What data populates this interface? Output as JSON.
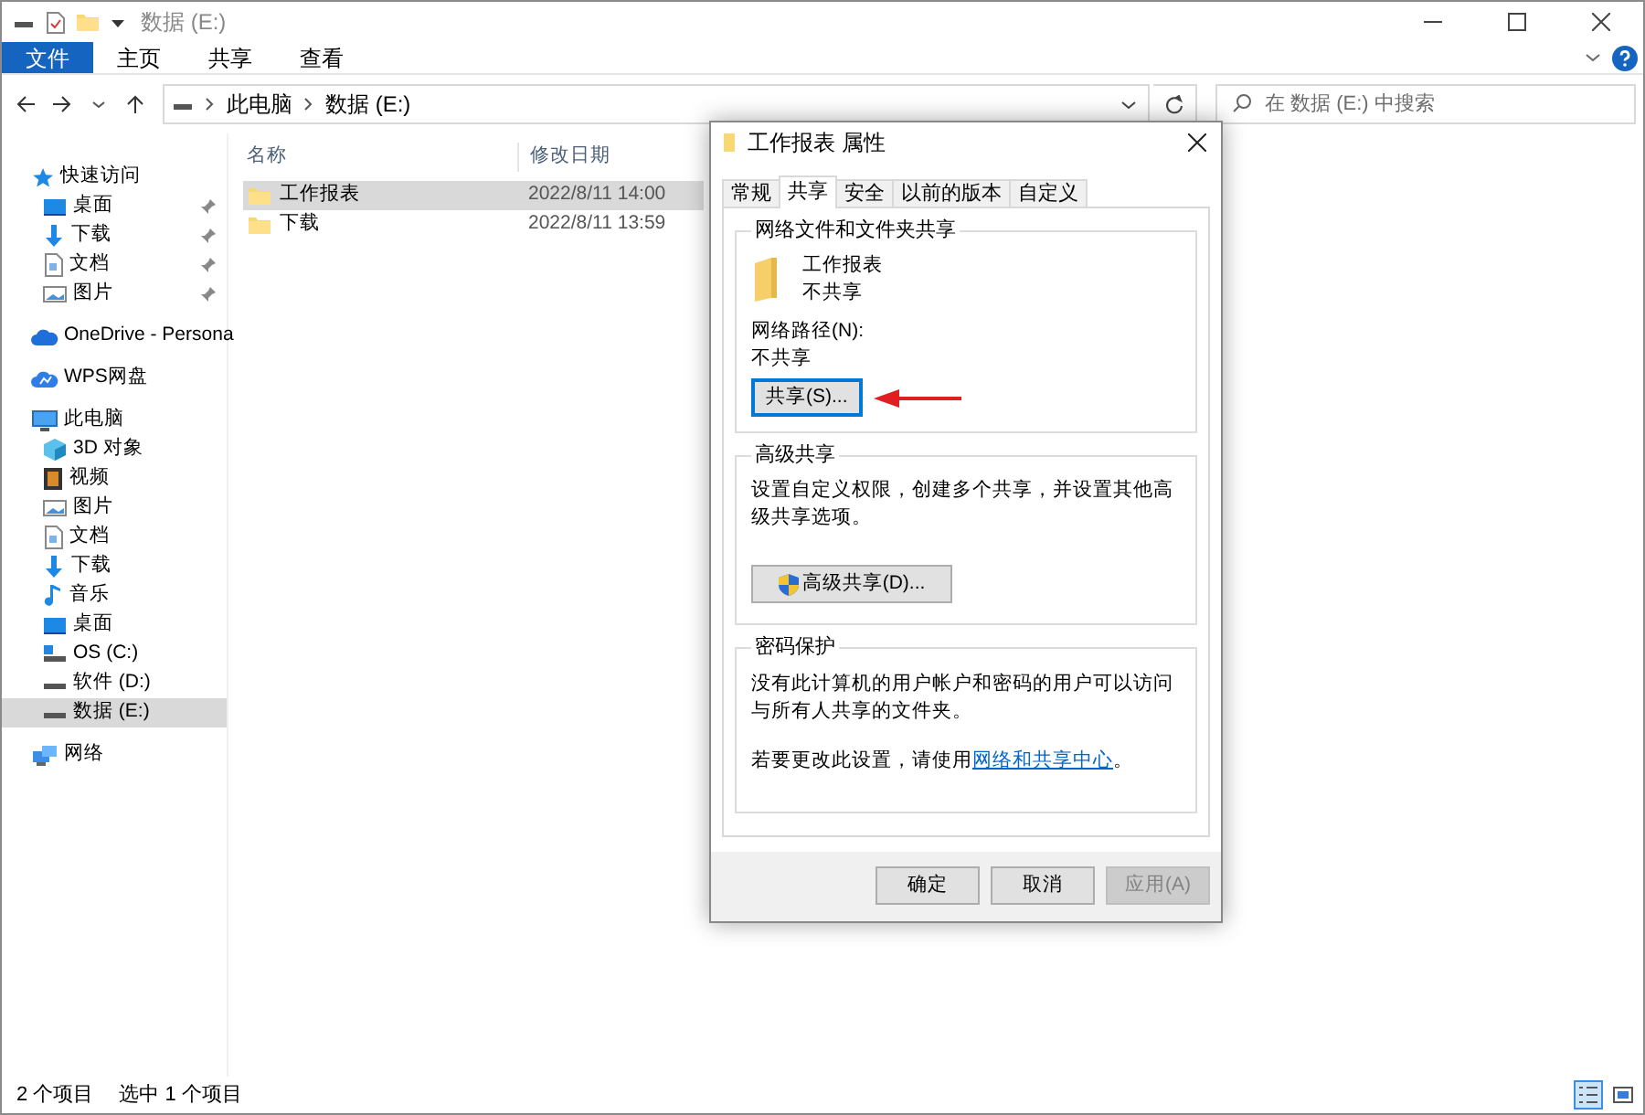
{
  "title_bar": {
    "title": "数据 (E:)"
  },
  "ribbon_tabs": [
    {
      "label": "文件",
      "selected": true
    },
    {
      "label": "主页",
      "selected": false
    },
    {
      "label": "共享",
      "selected": false
    },
    {
      "label": "查看",
      "selected": false
    }
  ],
  "address_bar": {
    "breadcrumbs": [
      "此电脑",
      "数据 (E:)"
    ]
  },
  "search": {
    "placeholder": "在 数据 (E:) 中搜索"
  },
  "sidebar": {
    "items": [
      {
        "label": "快速访问",
        "kind": "star",
        "selected": false,
        "children": [
          {
            "label": "桌面",
            "kind": "desktop",
            "pinned": true,
            "selected": false
          },
          {
            "label": "下载",
            "kind": "download",
            "pinned": true,
            "selected": false
          },
          {
            "label": "文档",
            "kind": "document",
            "pinned": true,
            "selected": false
          },
          {
            "label": "图片",
            "kind": "picture",
            "pinned": true,
            "selected": false
          }
        ]
      },
      {
        "label": "OneDrive - Persona",
        "kind": "cloud",
        "selected": false
      },
      {
        "label": "WPS网盘",
        "kind": "wps",
        "selected": false
      },
      {
        "label": "此电脑",
        "kind": "pc",
        "selected": false,
        "children": [
          {
            "label": "3D 对象",
            "kind": "cube",
            "selected": false
          },
          {
            "label": "视频",
            "kind": "video",
            "selected": false
          },
          {
            "label": "图片",
            "kind": "picture",
            "selected": false
          },
          {
            "label": "文档",
            "kind": "document",
            "selected": false
          },
          {
            "label": "下载",
            "kind": "download",
            "selected": false
          },
          {
            "label": "音乐",
            "kind": "music",
            "selected": false
          },
          {
            "label": "桌面",
            "kind": "desktop",
            "selected": false
          },
          {
            "label": "OS (C:)",
            "kind": "osdrive",
            "selected": false
          },
          {
            "label": "软件 (D:)",
            "kind": "drive",
            "selected": false
          },
          {
            "label": "数据 (E:)",
            "kind": "drive",
            "selected": true
          }
        ]
      },
      {
        "label": "网络",
        "kind": "network",
        "selected": false
      }
    ]
  },
  "file_list": {
    "columns": [
      "名称",
      "修改日期"
    ],
    "rows": [
      {
        "name": "工作报表",
        "modified": "2022/8/11 14:00",
        "selected": true
      },
      {
        "name": "下载",
        "modified": "2022/8/11 13:59",
        "selected": false
      }
    ]
  },
  "status_bar": {
    "item_count": "2 个项目",
    "selection": "选中 1 个项目"
  },
  "dialog": {
    "title": "工作报表 属性",
    "tabs": [
      {
        "label": "常规",
        "selected": false
      },
      {
        "label": "共享",
        "selected": true
      },
      {
        "label": "安全",
        "selected": false
      },
      {
        "label": "以前的版本",
        "selected": false
      },
      {
        "label": "自定义",
        "selected": false
      }
    ],
    "network_sharing": {
      "title": "网络文件和文件夹共享",
      "folder_name": "工作报表",
      "folder_status": "不共享",
      "path_label": "网络路径(N):",
      "path_value": "不共享",
      "button": "共享(S)..."
    },
    "advanced_sharing": {
      "title": "高级共享",
      "description": "设置自定义权限，创建多个共享，并设置其他高级共享选项。",
      "button": "高级共享(D)..."
    },
    "password_protection": {
      "title": "密码保护",
      "description": "没有此计算机的用户帐户和密码的用户可以访问与所有人共享的文件夹。",
      "change_before": "若要更改此设置，请使用",
      "change_link": "网络和共享中心",
      "change_after": "。"
    },
    "buttons": [
      {
        "label": "确定",
        "disabled": false
      },
      {
        "label": "取消",
        "disabled": false
      },
      {
        "label": "应用(A)",
        "disabled": true
      }
    ]
  }
}
